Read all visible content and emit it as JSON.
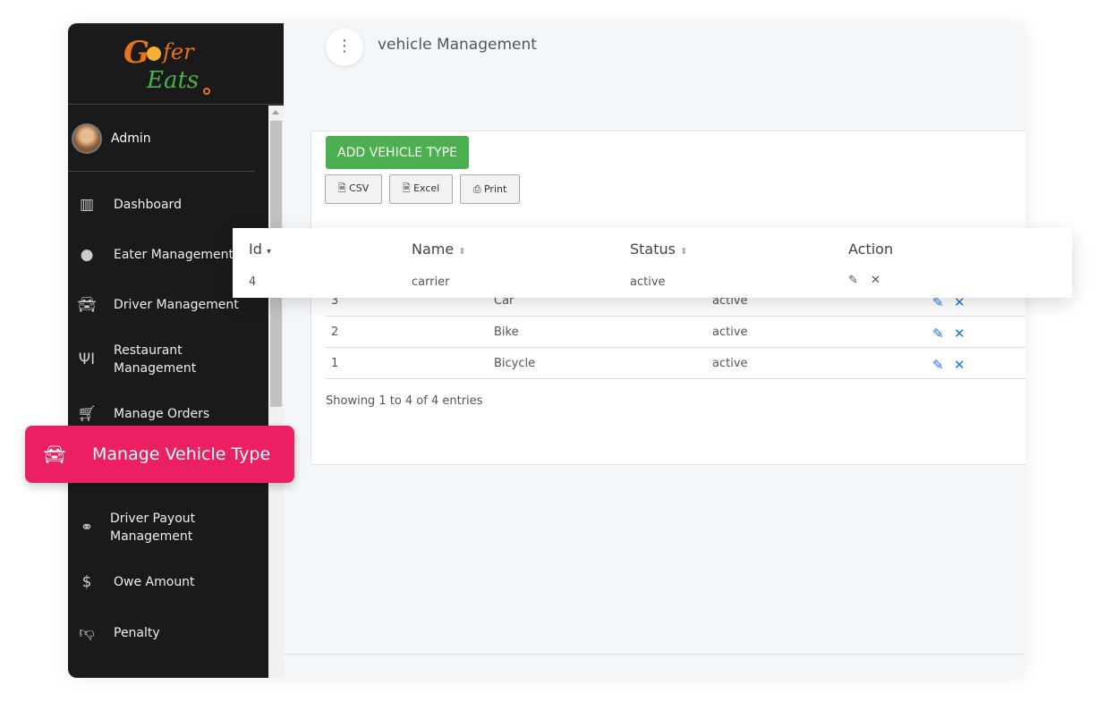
{
  "brand": {
    "logo_text": "Gofer Eats"
  },
  "user": {
    "name": "Admin"
  },
  "sidebar": {
    "items": [
      {
        "label": "Dashboard",
        "icon": "bar-chart-icon"
      },
      {
        "label": "Eater Management",
        "icon": "user-circle-icon"
      },
      {
        "label": "Driver Management",
        "icon": "car-icon"
      },
      {
        "label": "Restaurant Management",
        "icon": "utensils-icon"
      },
      {
        "label": "Manage Orders",
        "icon": "cart-plus-icon"
      },
      {
        "label": "Driver Payout Management",
        "icon": "motorcycle-icon"
      },
      {
        "label": "Owe Amount",
        "icon": "dollar-icon"
      },
      {
        "label": "Penalty",
        "icon": "thumbs-down-icon"
      }
    ],
    "active": {
      "label": "Manage Vehicle Type",
      "icon": "car-icon",
      "color": "#ec1f62"
    }
  },
  "header": {
    "title": "vehicle Management"
  },
  "toolbar": {
    "add_label": "ADD VEHICLE TYPE",
    "csv": "CSV",
    "excel": "Excel",
    "print": "Print"
  },
  "table": {
    "columns": [
      "Id",
      "Name",
      "Status",
      "Action"
    ],
    "rows": [
      {
        "id": "4",
        "name": "carrier",
        "status": "active"
      },
      {
        "id": "3",
        "name": "Car",
        "status": "active"
      },
      {
        "id": "2",
        "name": "Bike",
        "status": "active"
      },
      {
        "id": "1",
        "name": "Bicycle",
        "status": "active"
      }
    ],
    "info": "Showing 1 to 4 of 4 entries"
  }
}
